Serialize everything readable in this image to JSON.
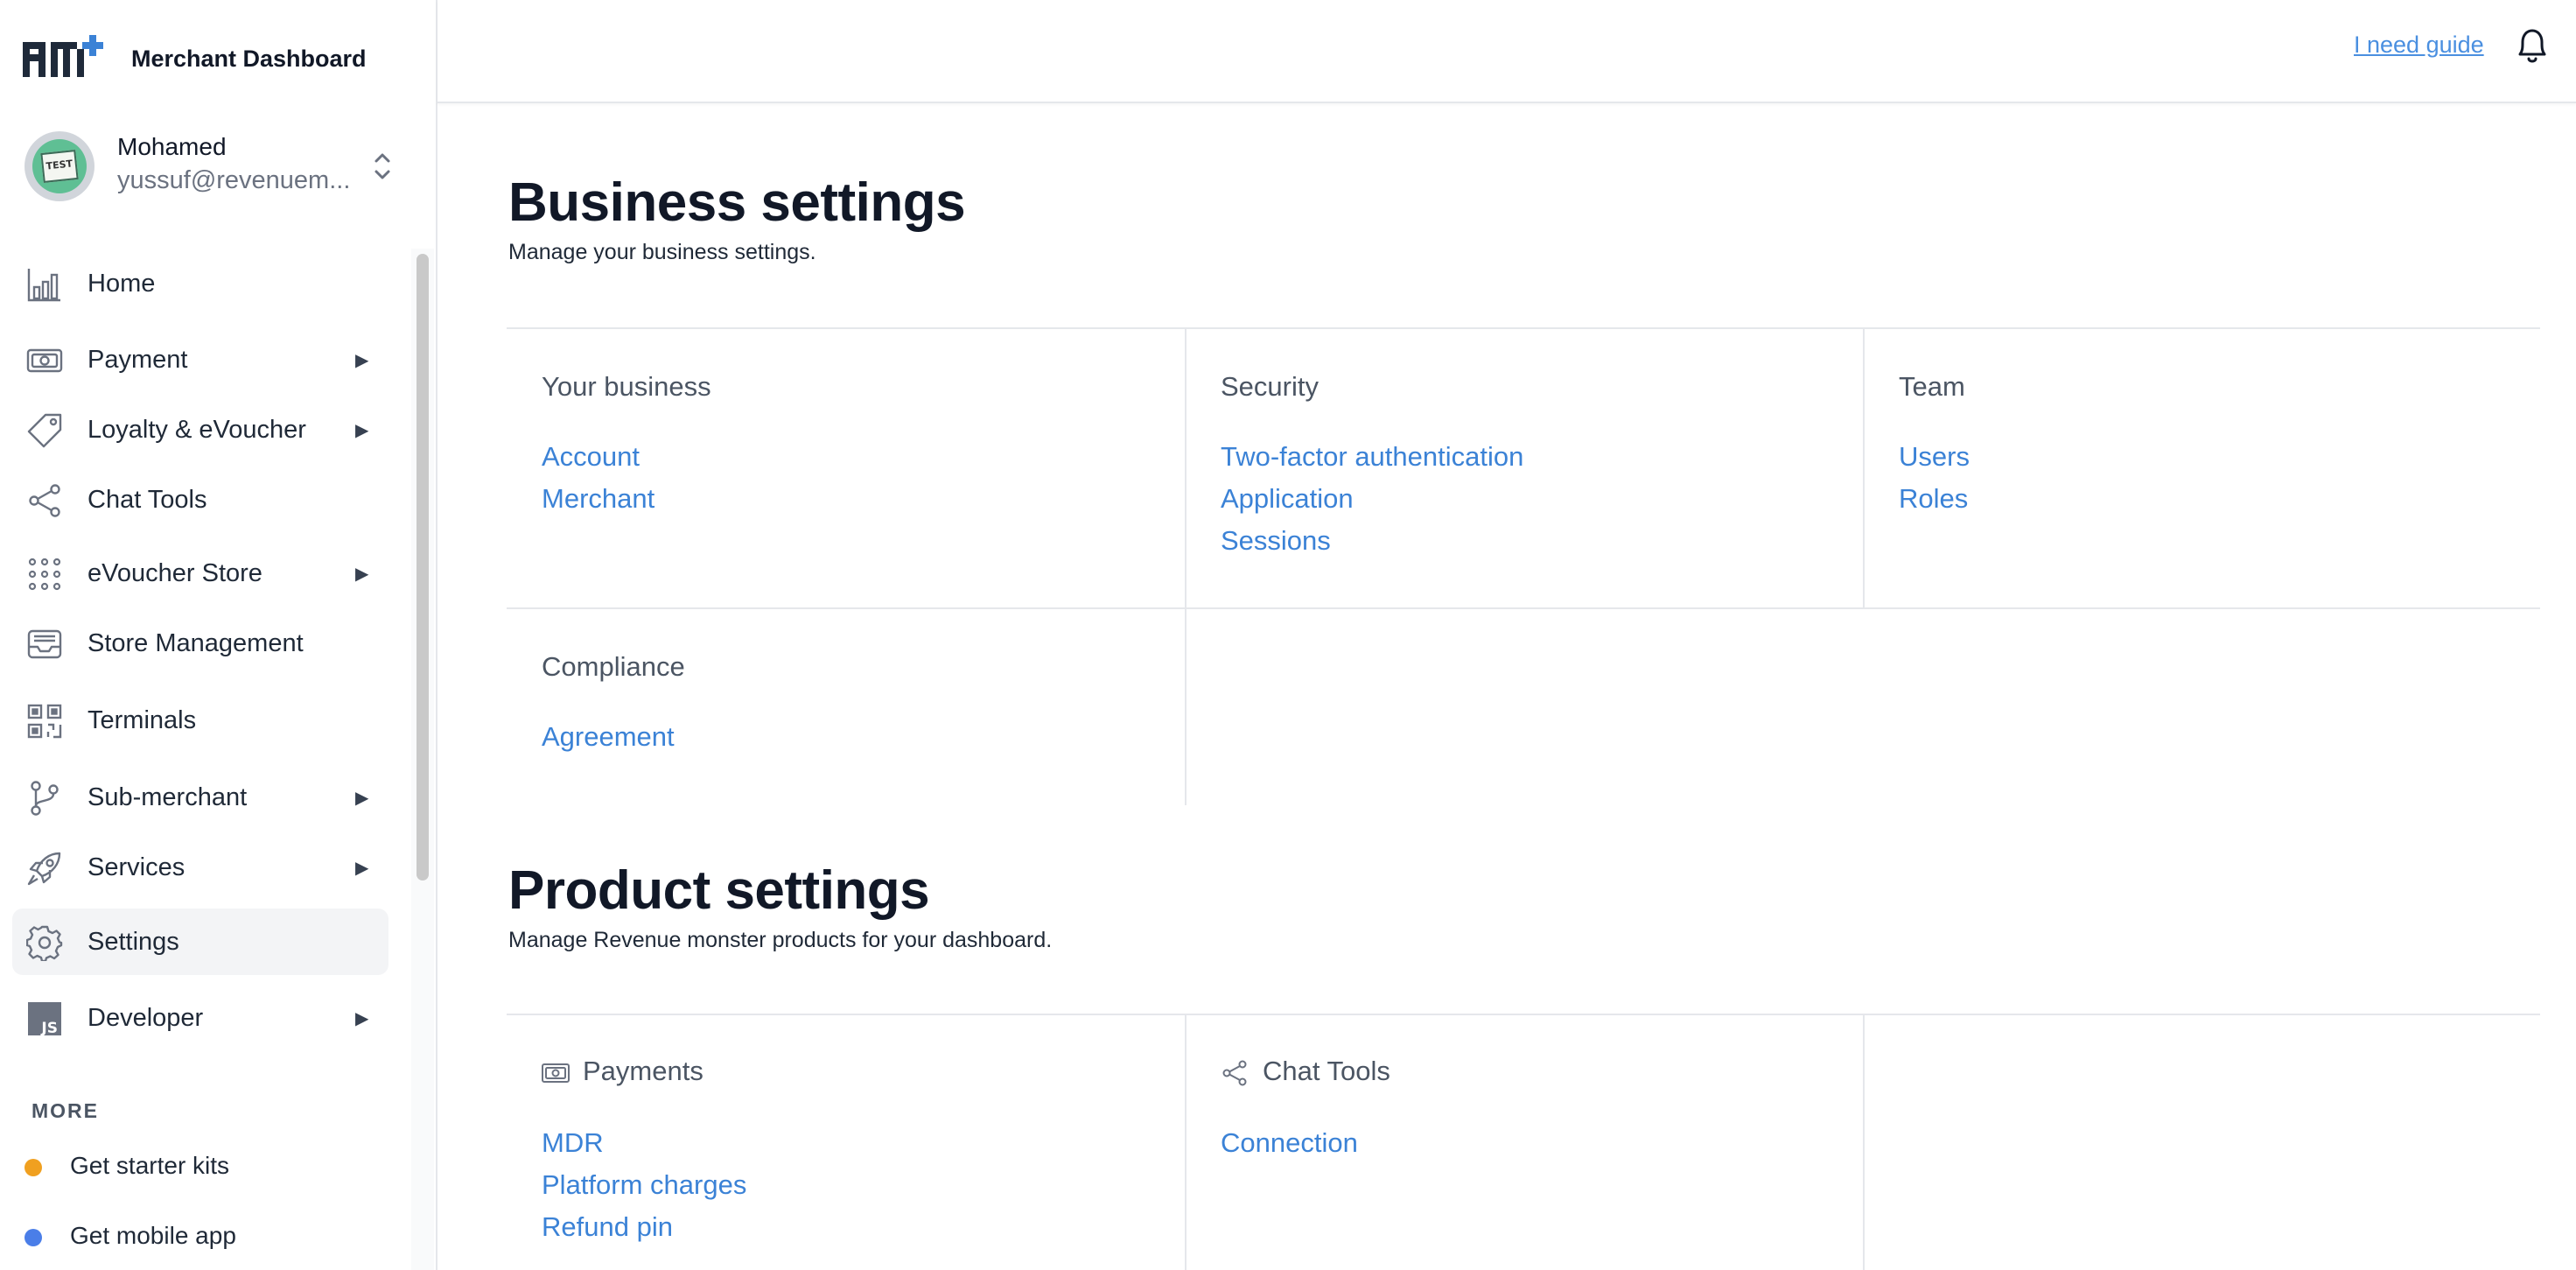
{
  "brand": {
    "title": "Merchant Dashboard"
  },
  "profile": {
    "name": "Mohamed",
    "email": "yussuf@revenuem...",
    "avatar_text": "TEST"
  },
  "header": {
    "guide_link": "I need guide"
  },
  "sidebar": {
    "items": [
      {
        "label": "Home",
        "icon": "bar-chart-icon",
        "has_submenu": false
      },
      {
        "label": "Payment",
        "icon": "banknote-icon",
        "has_submenu": true
      },
      {
        "label": "Loyalty & eVoucher",
        "icon": "tag-icon",
        "has_submenu": true
      },
      {
        "label": "Chat Tools",
        "icon": "share-icon",
        "has_submenu": false
      },
      {
        "label": "eVoucher Store",
        "icon": "grid-dots-icon",
        "has_submenu": true
      },
      {
        "label": "Store Management",
        "icon": "inbox-icon",
        "has_submenu": false
      },
      {
        "label": "Terminals",
        "icon": "qr-code-icon",
        "has_submenu": false
      },
      {
        "label": "Sub-merchant",
        "icon": "git-branch-icon",
        "has_submenu": true
      },
      {
        "label": "Services",
        "icon": "rocket-icon",
        "has_submenu": true
      },
      {
        "label": "Settings",
        "icon": "gear-icon",
        "has_submenu": false,
        "active": true
      },
      {
        "label": "Developer",
        "icon": "js-icon",
        "has_submenu": true
      }
    ],
    "more_header": "MORE",
    "more_items": [
      {
        "label": "Get starter kits",
        "dot_color": "#f0a020"
      },
      {
        "label": "Get mobile app",
        "dot_color": "#4a7ee8"
      }
    ]
  },
  "business": {
    "title": "Business settings",
    "subtitle": "Manage your business settings.",
    "groups": [
      {
        "title": "Your business",
        "links": [
          "Account",
          "Merchant"
        ]
      },
      {
        "title": "Security",
        "links": [
          "Two-factor authentication",
          "Application",
          "Sessions"
        ]
      },
      {
        "title": "Team",
        "links": [
          "Users",
          "Roles"
        ]
      },
      {
        "title": "Compliance",
        "links": [
          "Agreement"
        ]
      }
    ]
  },
  "product": {
    "title": "Product settings",
    "subtitle": "Manage Revenue monster products for your dashboard.",
    "groups": [
      {
        "title": "Payments",
        "icon": "banknote-icon",
        "links": [
          "MDR",
          "Platform charges",
          "Refund pin"
        ]
      },
      {
        "title": "Chat Tools",
        "icon": "share-icon",
        "links": [
          "Connection"
        ]
      }
    ]
  },
  "colors": {
    "link": "#3b82d6",
    "active_bg": "#f3f4f6",
    "accent": "#4a8fe0"
  }
}
